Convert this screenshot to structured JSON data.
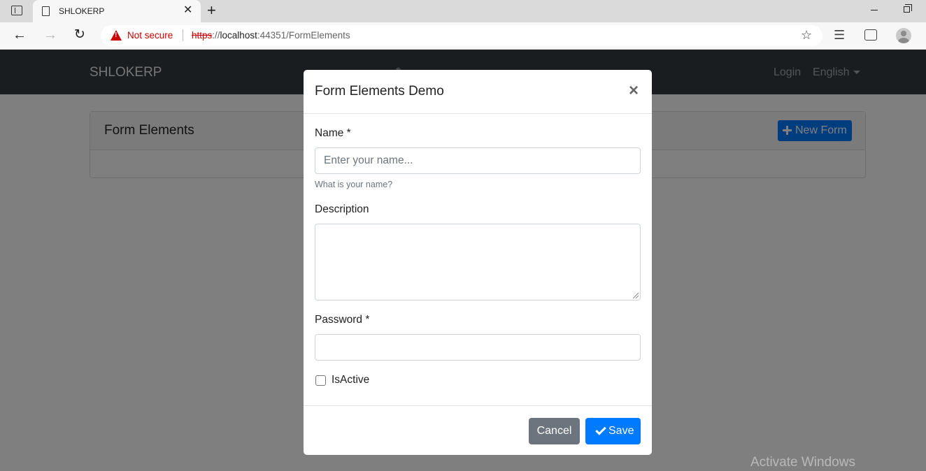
{
  "browser": {
    "tab_title": "SHLOKERP",
    "security_label": "Not secure",
    "url_protocol": "https",
    "url_sep": "://",
    "url_host": "localhost",
    "url_rest": ":44351/FormElements"
  },
  "app": {
    "brand": "SHLOKERP",
    "login": "Login",
    "language": "English"
  },
  "card": {
    "title": "Form Elements",
    "new_form_label": "New Form"
  },
  "modal": {
    "title": "Form Elements Demo",
    "close": "×",
    "name_label": "Name *",
    "name_placeholder": "Enter your name...",
    "name_help": "What is your name?",
    "description_label": "Description",
    "password_label": "Password *",
    "isactive_label": "IsActive",
    "isactive_checked": false,
    "cancel_label": "Cancel",
    "save_label": "Save"
  },
  "watermark": "Activate Windows",
  "colors": {
    "primary": "#007bff",
    "secondary": "#6c757d",
    "navbar": "#343a40",
    "danger": "#cc0000"
  }
}
